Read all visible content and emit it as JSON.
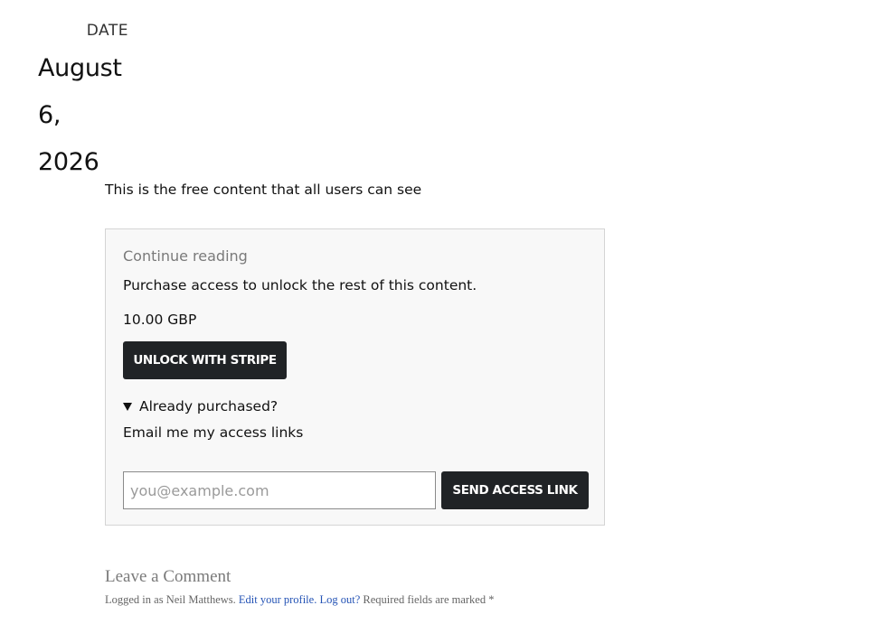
{
  "date": {
    "label": "DATE",
    "line1": "August",
    "line2": "6, 2026"
  },
  "content": {
    "free_text": "This is the free content that all users can see"
  },
  "paywall": {
    "title": "Continue reading",
    "description": "Purchase access to unlock the rest of this content.",
    "price": "10.00 GBP",
    "unlock_button": "UNLOCK WITH STRIPE",
    "already_purchased": "Already purchased?",
    "email_label": "Email me my access links",
    "email_placeholder": "you@example.com",
    "email_value": "",
    "send_button": "SEND ACCESS LINK"
  },
  "comments": {
    "title": "Leave a Comment",
    "logged_in_prefix": "Logged in as Neil Matthews.",
    "edit_profile": "Edit your profile.",
    "log_out": "Log out?",
    "required_note": "Required fields are marked *"
  },
  "colors": {
    "button_bg": "#202326",
    "link": "#2453b5",
    "paywall_bg": "#f8f8f8"
  }
}
